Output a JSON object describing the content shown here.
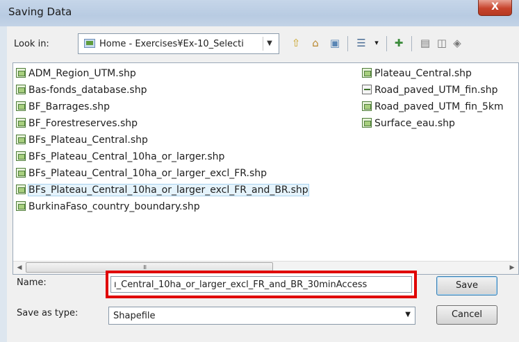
{
  "window": {
    "title": "Saving Data",
    "close_glyph": "X"
  },
  "lookin": {
    "label": "Look in:",
    "value": "Home - Exercises¥Ex-10_Selecti",
    "icon": "folder-icon"
  },
  "toolbar": [
    {
      "name": "up-one-level-icon",
      "glyph": "⇧"
    },
    {
      "name": "home-icon",
      "glyph": "⌂"
    },
    {
      "name": "connect-folder-icon",
      "glyph": "▣"
    },
    {
      "name": "list-view-icon",
      "glyph": "☰"
    },
    {
      "name": "view-dropdown-icon",
      "glyph": "▾"
    },
    {
      "name": "new-folder-icon",
      "glyph": "✚"
    },
    {
      "name": "details-icon",
      "glyph": "▤"
    },
    {
      "name": "catalog-icon",
      "glyph": "◫"
    },
    {
      "name": "delete-icon",
      "glyph": "◈"
    }
  ],
  "files_left": [
    {
      "label": "ADM_Region_UTM.shp",
      "icon": "polygon-shapefile-icon"
    },
    {
      "label": "Bas-fonds_database.shp",
      "icon": "polygon-shapefile-icon"
    },
    {
      "label": "BF_Barrages.shp",
      "icon": "polygon-shapefile-icon"
    },
    {
      "label": "BF_Forestreserves.shp",
      "icon": "polygon-shapefile-icon"
    },
    {
      "label": "BFs_Plateau_Central.shp",
      "icon": "polygon-shapefile-icon"
    },
    {
      "label": "BFs_Plateau_Central_10ha_or_larger.shp",
      "icon": "polygon-shapefile-icon"
    },
    {
      "label": "BFs_Plateau_Central_10ha_or_larger_excl_FR.shp",
      "icon": "polygon-shapefile-icon"
    },
    {
      "label": "BFs_Plateau_Central_10ha_or_larger_excl_FR_and_BR.shp",
      "icon": "polygon-shapefile-icon",
      "selected": true
    },
    {
      "label": "BurkinaFaso_country_boundary.shp",
      "icon": "polygon-shapefile-icon"
    }
  ],
  "files_right": [
    {
      "label": "Plateau_Central.shp",
      "icon": "polygon-shapefile-icon"
    },
    {
      "label": "Road_paved_UTM_fin.shp",
      "icon": "line-shapefile-icon"
    },
    {
      "label": "Road_paved_UTM_fin_5km",
      "icon": "polygon-shapefile-icon"
    },
    {
      "label": "Surface_eau.shp",
      "icon": "polygon-shapefile-icon"
    }
  ],
  "scrollbar": {
    "left_arrow": "◀",
    "right_arrow": "▶",
    "grip": "III"
  },
  "name": {
    "label": "Name:",
    "value": "ı_Central_10ha_or_larger_excl_FR_and_BR_30minAccess"
  },
  "save_as_type": {
    "label": "Save as type:",
    "value": "Shapefile",
    "arrow": "▼"
  },
  "buttons": {
    "save": "Save",
    "cancel": "Cancel"
  }
}
